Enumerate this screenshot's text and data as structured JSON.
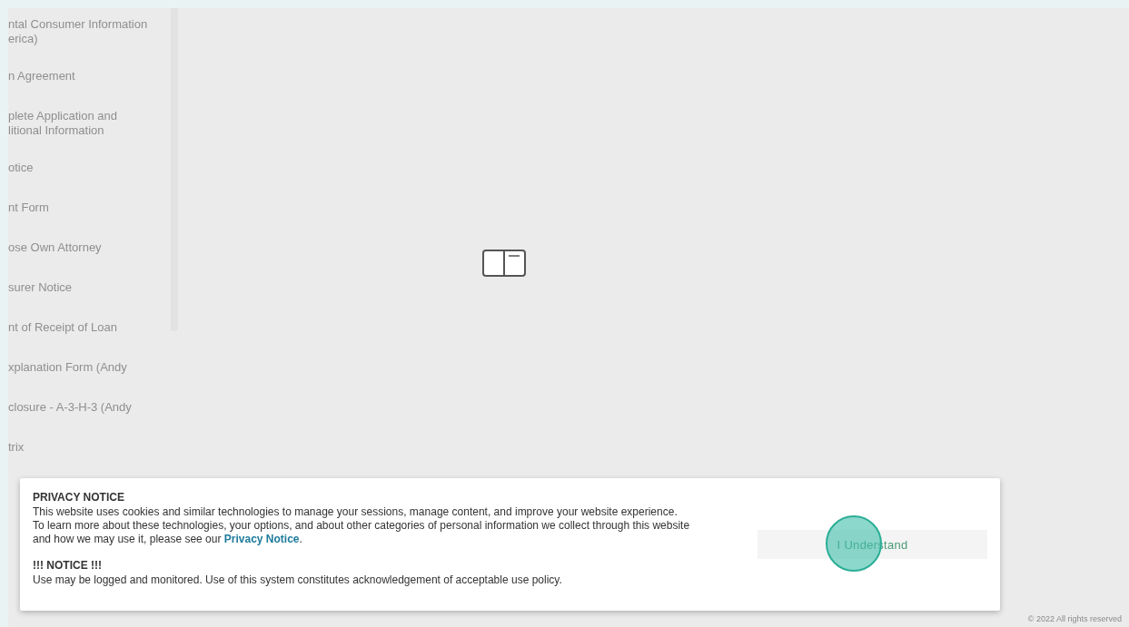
{
  "sidebar": {
    "items": [
      {
        "label": "ntal Consumer Information\nerica)"
      },
      {
        "label": "n Agreement"
      },
      {
        "label": "plete Application and\nlitional Information"
      },
      {
        "label": "otice"
      },
      {
        "label": "nt Form"
      },
      {
        "label": "ose Own Attorney"
      },
      {
        "label": "surer Notice"
      },
      {
        "label": "nt of Receipt of Loan"
      },
      {
        "label": "xplanation Form (Andy"
      },
      {
        "label": "closure - A-3-H-3 (Andy"
      },
      {
        "label": "trix"
      }
    ]
  },
  "privacy_notice": {
    "title": "PRIVACY NOTICE",
    "body": "This website uses cookies and similar technologies to manage your sessions, manage content, and improve your website experience. To learn more about these technologies, your options, and about other categories of personal information we collect through this website and how we may use it, please see our",
    "link": "Privacy Notice",
    "after_link": ".",
    "notice_title": "!!! NOTICE !!!",
    "notice_body": "Use may be logged and monitored. Use of this system constitutes acknowledgement of acceptable use policy.",
    "button": "I Understand"
  },
  "footer": "© 2022 All rights reserved"
}
